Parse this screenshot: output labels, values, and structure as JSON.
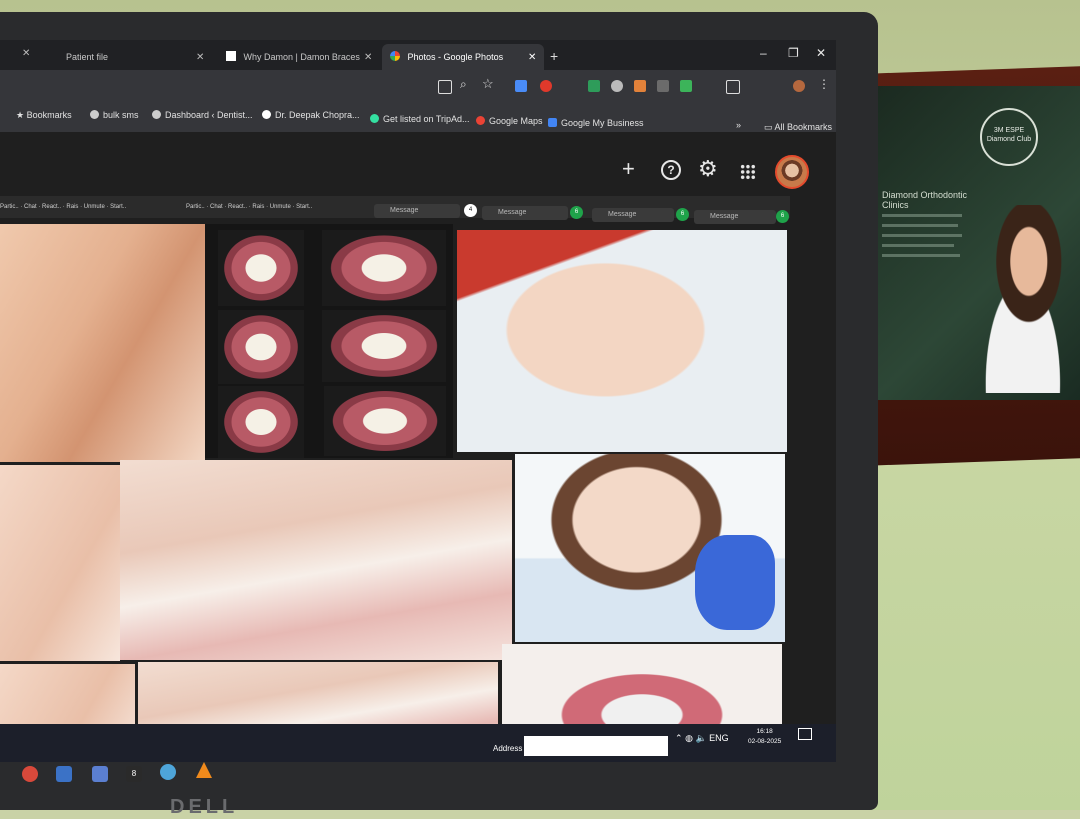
{
  "browser": {
    "tabs": [
      {
        "title": "Patient file",
        "active": false
      },
      {
        "title": "Why Damon | Damon Braces",
        "active": false
      },
      {
        "title": "Photos - Google Photos",
        "active": true
      }
    ],
    "new_tab_label": "+",
    "window_controls": {
      "minimize": "–",
      "restore": "❐",
      "close": "✕"
    },
    "tab_close": "✕",
    "bookmarks": [
      "Bookmarks",
      "bulk sms",
      "Dashboard ‹ Dentist...",
      "Dr. Deepak Chopra...",
      "Get listed on TripAd...",
      "Google Maps",
      "Google My Business"
    ],
    "bookmarks_more": "»",
    "all_bookmarks": "All Bookmarks"
  },
  "photos_header": {
    "add_icon": "+",
    "help_icon": "?",
    "settings_icon": "⚙",
    "apps_icon": "⋮⋮"
  },
  "meeting_strip": {
    "items": [
      "Partic..",
      "Chat",
      "React..",
      "Rais",
      "Unmute",
      "Start.."
    ],
    "message_placeholder": "Message",
    "badges": [
      "4",
      "6",
      "6",
      "6"
    ]
  },
  "frame_certificate": {
    "seal_text": "3M ESPE Diamond Club",
    "heading": "Diamond Orthodontic Clinics"
  },
  "taskbar": {
    "address_label": "Address",
    "language": "ENG",
    "time": "16:18",
    "date": "02-08-2025"
  },
  "brand": "DELL",
  "colors": {
    "browser_dark": "#202124",
    "toolbar": "#35363a",
    "photos_bg": "#1f1f1f",
    "avatar_ring": "#e44b2d",
    "badge_white": "#ffffff",
    "badge_green": "#1fa34a",
    "taskbar": "#1c1f2a"
  }
}
